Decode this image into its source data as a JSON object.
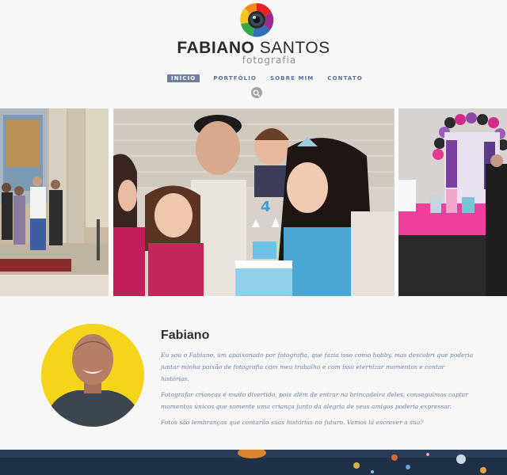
{
  "brand": {
    "name_bold": "FABIANO",
    "name_light": "SANTOS",
    "tagline": "fotografia"
  },
  "nav": {
    "items": [
      {
        "label": "INÍCIO",
        "active": true
      },
      {
        "label": "PORTFÓLIO",
        "active": false
      },
      {
        "label": "SOBRE MIM",
        "active": false
      },
      {
        "label": "CONTATO",
        "active": false
      }
    ]
  },
  "search": {
    "icon": "search-icon"
  },
  "gallery": {
    "photos": [
      {
        "name": "church-group-photo"
      },
      {
        "name": "birthday-cake-photo"
      },
      {
        "name": "party-decoration-photo"
      }
    ]
  },
  "about": {
    "title": "Fabiano",
    "paragraphs": [
      "Eu sou o Fabiano, um apaixonado por fotografia, que fazia isso como hobby, mas descobri que poderia juntar minha paixão de fotografia com meu trabalho e com isso eternizar momentos e contar histórias.",
      "Fotografar crianças é muito divertido, pois além de entrar na brincadeira deles, conseguimos captar momentos únicos que somente uma criança junto da alegria de seus amigos poderia expressar.",
      "Fotos são lembranças que contarão suas histórias no futuro.  Vamos lá escrever a sua?"
    ]
  },
  "colors": {
    "nav_active_bg": "#6d80a0",
    "nav_text": "#5a6f92",
    "body_text": "#6b7f9e",
    "avatar_bg": "#f5d51b",
    "footer_band": "#1f3048"
  }
}
